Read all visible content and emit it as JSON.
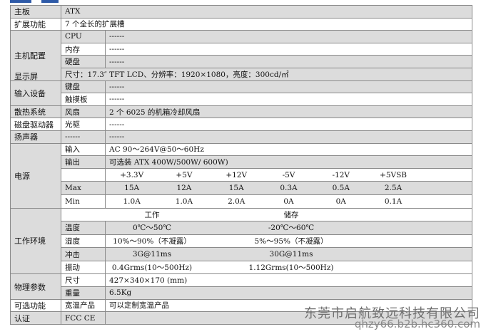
{
  "header_fragment": "",
  "spec": {
    "mb": {
      "label": "主板",
      "value": "ATX"
    },
    "exp": {
      "label": "扩展功能",
      "value": "7 个全长的扩展槽"
    },
    "host": {
      "label": "主机配置",
      "rows": [
        {
          "k": "CPU",
          "v": "------"
        },
        {
          "k": "内存",
          "v": "------"
        },
        {
          "k": "硬盘",
          "v": "------"
        }
      ]
    },
    "disp": {
      "label": "显示屏",
      "value": "尺寸：17.3″ TFT LCD、分辨率：1920×1080，亮度：300cd/㎡"
    },
    "input": {
      "label": "输入设备",
      "rows": [
        {
          "k": "键盘",
          "v": "------"
        },
        {
          "k": "触摸板",
          "v": "------"
        }
      ]
    },
    "cool": {
      "label": "散热系统",
      "k": "风扇",
      "v": "2 个 6025 的机箱冷却风扇"
    },
    "drive": {
      "label": "磁盘驱动器",
      "k": "光驱",
      "v": "------"
    },
    "spk": {
      "label": "扬声器",
      "k": "------",
      "v": "------"
    },
    "power": {
      "label": "电源",
      "input_k": "输入",
      "input_v": "AC 90～264V@50～60Hz",
      "output_k": "输出",
      "output_v": "可选装 ATX 400W/500W/ 600W)",
      "rails": [
        "+3.3V",
        "+5V",
        "+12V",
        "-5V",
        "-12V",
        "+5VSB"
      ],
      "max_k": "Max",
      "max": [
        "15A",
        "12A",
        "15A",
        "0.3A",
        "0.5A",
        "2.5A"
      ],
      "min_k": "Min",
      "min": [
        "1.0A",
        "1.0A",
        "2.0A",
        "0A",
        "0A",
        "0.1A"
      ]
    },
    "env": {
      "label": "工作环境",
      "head_work": "工作",
      "head_store": "储存",
      "rows": [
        {
          "k": "温度",
          "work": "0℃～50℃",
          "store": "-20℃～60℃"
        },
        {
          "k": "湿度",
          "work": "10%～90%（不凝露）",
          "store": "5%～95%（不凝露）"
        },
        {
          "k": "冲击",
          "work": "3G@11ms",
          "store": "30G@11ms"
        },
        {
          "k": "振动",
          "work": "0.4Grms(10～500Hz)",
          "store": "1.12Grms(10～500Hz)"
        }
      ]
    },
    "phys": {
      "label": "物理参数",
      "rows": [
        {
          "k": "尺寸",
          "v": "427×340×170 (mm)"
        },
        {
          "k": "重量",
          "v": "6.5Kg"
        }
      ]
    },
    "opt": {
      "label": "可选功能",
      "k": "宽温产品",
      "v": "可以定制宽温产品"
    },
    "cert": {
      "label": "认证",
      "k": "FCC CE",
      "v": ""
    }
  },
  "watermark": {
    "line1": "东莞市启航致远科技有限公司",
    "line2": "qhzy66.b2b.hc360.com"
  }
}
